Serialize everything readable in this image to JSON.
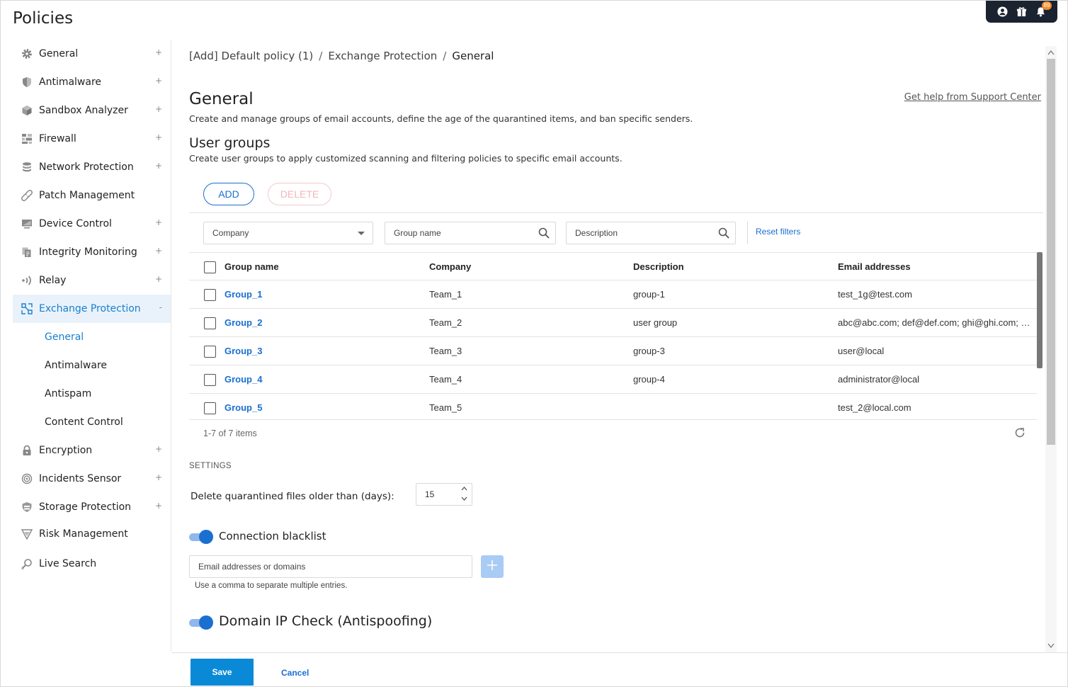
{
  "page_title": "Policies",
  "topbar": {
    "notifications_count": "89",
    "icons": [
      "user-icon",
      "gift-icon",
      "bell-icon"
    ]
  },
  "sidebar": {
    "items": [
      {
        "label": "General",
        "icon": "gear-icon",
        "expandable": true
      },
      {
        "label": "Antimalware",
        "icon": "shield-icon",
        "expandable": true
      },
      {
        "label": "Sandbox Analyzer",
        "icon": "cube-icon",
        "expandable": true
      },
      {
        "label": "Firewall",
        "icon": "firewall-icon",
        "expandable": true
      },
      {
        "label": "Network Protection",
        "icon": "database-icon",
        "expandable": true
      },
      {
        "label": "Patch Management",
        "icon": "bandage-icon",
        "expandable": false
      },
      {
        "label": "Device Control",
        "icon": "monitor-icon",
        "expandable": true
      },
      {
        "label": "Integrity Monitoring",
        "icon": "files-icon",
        "expandable": true
      },
      {
        "label": "Relay",
        "icon": "relay-icon",
        "expandable": true
      },
      {
        "label": "Exchange Protection",
        "icon": "exchange-icon",
        "expandable": true,
        "active": true,
        "collapse_symbol": "-"
      },
      {
        "label": "Encryption",
        "icon": "lock-icon",
        "expandable": true
      },
      {
        "label": "Incidents Sensor",
        "icon": "sensor-icon",
        "expandable": true
      },
      {
        "label": "Storage Protection",
        "icon": "storage-icon",
        "expandable": true
      },
      {
        "label": "Risk Management",
        "icon": "risk-icon",
        "expandable": false
      },
      {
        "label": "Live Search",
        "icon": "live-search-icon",
        "expandable": false
      }
    ],
    "subitems": [
      "General",
      "Antimalware",
      "Antispam",
      "Content Control"
    ],
    "plus_symbol": "+"
  },
  "breadcrumb": [
    "[Add] Default policy (1)",
    "Exchange Protection",
    "General"
  ],
  "breadcrumb_sep": "/",
  "main": {
    "title": "General",
    "help_link": "Get help from Support Center",
    "description": "Create and manage groups of email accounts, define the age of the quarantined items, and ban specific senders.",
    "user_groups_title": "User groups",
    "user_groups_desc": "Create user groups to apply customized scanning and filtering policies to specific email accounts.",
    "add_label": "ADD",
    "delete_label": "DELETE"
  },
  "filters": {
    "company_placeholder": "Company",
    "group_name_placeholder": "Group name",
    "description_placeholder": "Description",
    "reset": "Reset filters"
  },
  "table": {
    "columns": [
      "Group name",
      "Company",
      "Description",
      "Email addresses"
    ],
    "rows": [
      [
        "Group_1",
        "Team_1",
        "group-1",
        "test_1g@test.com"
      ],
      [
        "Group_2",
        "Team_2",
        "user group",
        "abc@abc.com; def@def.com; ghi@ghi.com; jkl@jkl.com"
      ],
      [
        "Group_3",
        "Team_3",
        "group-3",
        "user@local"
      ],
      [
        "Group_4",
        "Team_4",
        "group-4",
        "administrator@local"
      ],
      [
        "Group_5",
        "Team_5",
        "",
        "test_2@local.com"
      ]
    ],
    "items_label": "1-7 of 7 items"
  },
  "settings": {
    "label": "SETTINGS",
    "delete_quarantined_label": "Delete quarantined files older than (days):",
    "delete_quarantined_value": "15",
    "connection_blacklist": "Connection blacklist",
    "email_placeholder": "Email addresses or domains",
    "hint": "Use a comma to separate multiple entries.",
    "domain_ip_check": "Domain IP Check (Antispoofing)"
  },
  "footer": {
    "save": "Save",
    "cancel": "Cancel"
  },
  "colors": {
    "accent": "#1a6fd1",
    "active_bg": "#e9f2fb",
    "save_bg": "#0a8ad6",
    "topbar_bg": "#1b2230"
  }
}
